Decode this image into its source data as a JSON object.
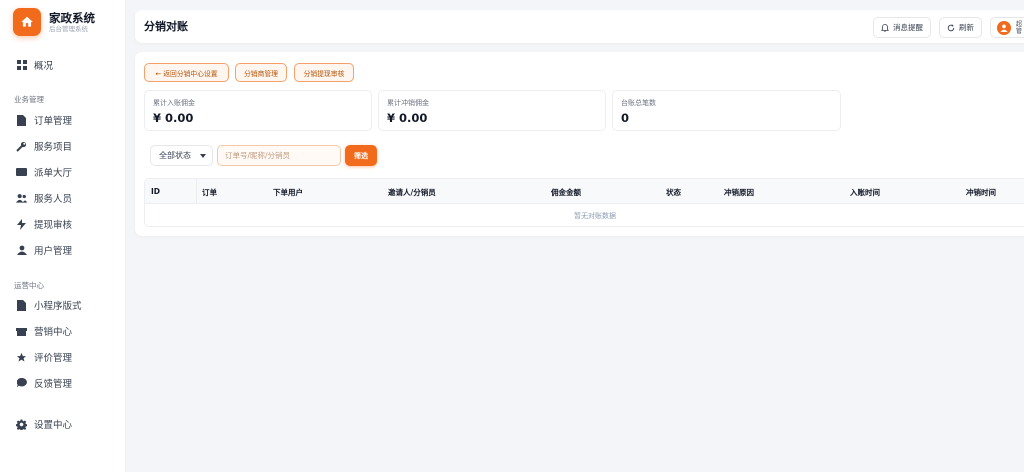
{
  "brand": {
    "title": "家政系统",
    "subtitle": "后台管理系统"
  },
  "nav": {
    "overview": "概况",
    "section_business": "业务管理",
    "orders": "订单管理",
    "services": "服务项目",
    "dispatch": "派单大厅",
    "staff": "服务人员",
    "withdraw": "提现审核",
    "users": "用户管理",
    "section_ops": "运营中心",
    "miniapp": "小程序版式",
    "marketing": "营销中心",
    "reviews": "评价管理",
    "feedback": "反馈管理",
    "settings": "设置中心"
  },
  "header": {
    "title": "分销对账",
    "notify_label": "消息提醒",
    "refresh_label": "刷新",
    "user_line1": "超",
    "user_line2": "管"
  },
  "actions": {
    "back": "← 返回分销中心设置",
    "manage": "分销商管理",
    "withdraw_review": "分销提现审核"
  },
  "stats": [
    {
      "label": "累计入账佣金",
      "value": "¥ 0.00"
    },
    {
      "label": "累计冲销佣金",
      "value": "¥ 0.00"
    },
    {
      "label": "台账总笔数",
      "value": "0"
    }
  ],
  "filters": {
    "status_selected": "全部状态",
    "search_placeholder": "订单号/昵称/分销员",
    "filter_label": "筛选"
  },
  "table": {
    "columns": [
      "ID",
      "订单",
      "下单用户",
      "邀请人/分销员",
      "佣金金额",
      "状态",
      "冲销原因",
      "入账时间",
      "冲销时间"
    ],
    "empty_text": "暂无对账数据"
  },
  "colors": {
    "accent": "#f26a1b"
  }
}
